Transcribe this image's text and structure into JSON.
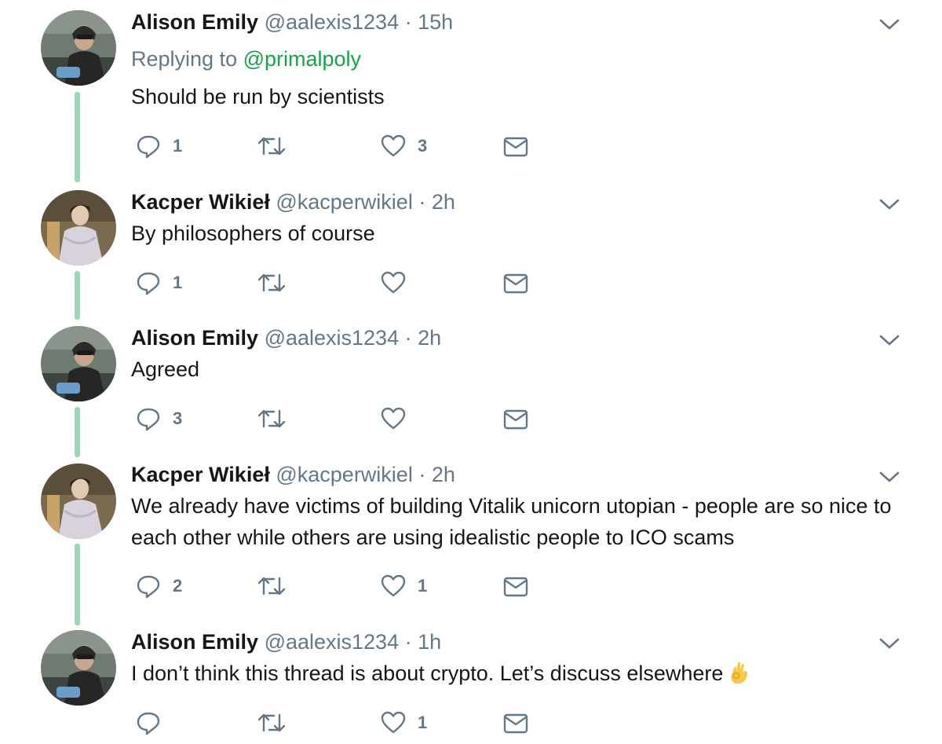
{
  "tweets": [
    {
      "author": "Alison Emily",
      "handle": "@aalexis1234",
      "separator": "·",
      "time": "15h",
      "replying_prefix": "Replying to",
      "replying_to": "@primalpoly",
      "text": "Should be run by scientists",
      "reply_count": "1",
      "retweet_count": "",
      "like_count": "3"
    },
    {
      "author": "Kacper Wikieł",
      "handle": "@kacperwikiel",
      "separator": "·",
      "time": "2h",
      "text": "By philosophers of course",
      "reply_count": "1",
      "retweet_count": "",
      "like_count": ""
    },
    {
      "author": "Alison Emily",
      "handle": "@aalexis1234",
      "separator": "·",
      "time": "2h",
      "text": "Agreed",
      "reply_count": "3",
      "retweet_count": "",
      "like_count": ""
    },
    {
      "author": "Kacper Wikieł",
      "handle": "@kacperwikiel",
      "separator": "·",
      "time": "2h",
      "text": "We already have victims of building  Vitalik unicorn utopian - people are so nice to each other while others are using idealistic people to ICO scams",
      "reply_count": "2",
      "retweet_count": "",
      "like_count": "1"
    },
    {
      "author": "Alison Emily",
      "handle": "@aalexis1234",
      "separator": "·",
      "time": "1h",
      "text": "I don’t think this thread is about crypto. Let’s discuss elsewhere",
      "reply_count": "",
      "retweet_count": "",
      "like_count": "1"
    }
  ],
  "icons": {
    "reply": "reply-icon",
    "retweet": "retweet-icon",
    "like": "heart-icon",
    "dm": "envelope-icon",
    "caret": "chevron-down-icon",
    "emoji": "ok-hand-emoji-icon"
  },
  "colors": {
    "thread_line": "#9ad9b5",
    "mention": "#17a24a",
    "secondary_text": "#657786",
    "primary_text": "#14171a"
  }
}
